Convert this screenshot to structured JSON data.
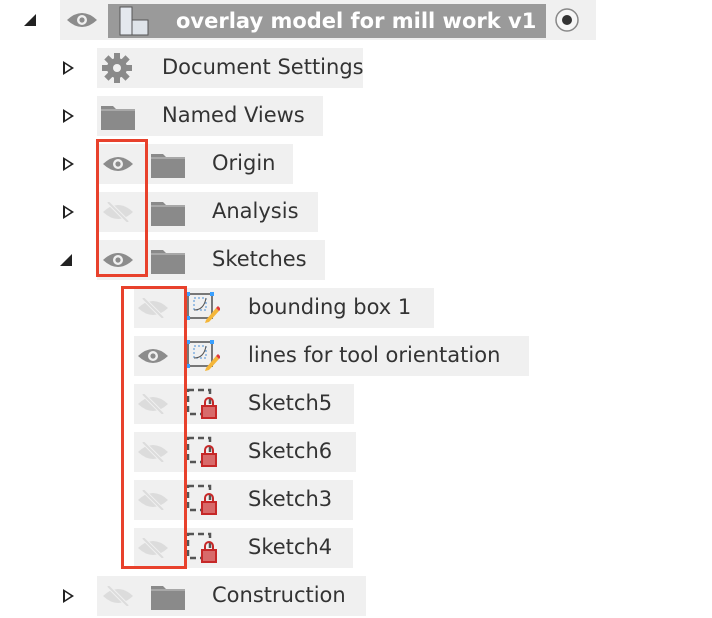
{
  "root": {
    "label": "overlay model for mill work v1",
    "expanded": true
  },
  "items": [
    {
      "label": "Document Settings",
      "icon": "gear-icon",
      "expanded": false
    },
    {
      "label": "Named Views",
      "icon": "folder-icon",
      "expanded": false
    },
    {
      "label": "Origin",
      "icon": "folder-icon",
      "visible": true,
      "expanded": false
    },
    {
      "label": "Analysis",
      "icon": "folder-icon",
      "visible": false,
      "expanded": false
    },
    {
      "label": "Sketches",
      "icon": "folder-icon",
      "visible": true,
      "expanded": true
    },
    {
      "label": "Construction",
      "icon": "folder-icon",
      "visible": false,
      "expanded": false
    }
  ],
  "sketches": [
    {
      "label": "bounding box 1",
      "visible": false,
      "locked": false
    },
    {
      "label": "lines for tool orientation",
      "visible": true,
      "locked": false
    },
    {
      "label": "Sketch5",
      "visible": false,
      "locked": true
    },
    {
      "label": "Sketch6",
      "visible": false,
      "locked": true
    },
    {
      "label": "Sketch3",
      "visible": false,
      "locked": true
    },
    {
      "label": "Sketch4",
      "visible": false,
      "locked": true
    }
  ],
  "colors": {
    "highlight": "#e8412c",
    "row": "#f0f0f0",
    "rootBar": "#9a9a9a"
  }
}
